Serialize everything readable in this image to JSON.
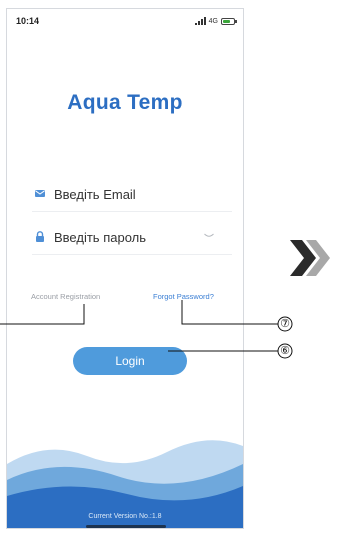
{
  "status_bar": {
    "time": "10:14",
    "network": "4G",
    "icons": [
      "signal-icon",
      "battery-icon"
    ]
  },
  "app": {
    "title": "Aqua Temp",
    "brand_color": "#2c6ec2"
  },
  "login_form": {
    "email_placeholder": "Введіть Email",
    "password_placeholder": "Введіть пароль",
    "email_icon": "mail-icon",
    "password_icon": "lock-icon",
    "password_toggle_icon": "eye-icon"
  },
  "links": {
    "register": "Account Registration",
    "forgot_password": "Forgot Password?"
  },
  "login_button": {
    "label": "Login",
    "color": "#4f9bdc"
  },
  "footer": {
    "version": "Current Version No.:1.8",
    "wave_colors": [
      "#bfd9f1",
      "#6fa8dc",
      "#2c6ec2"
    ]
  },
  "annotations": {
    "callouts": [
      "⑦",
      "⑥"
    ],
    "next_icon": "double-chevron-right-icon"
  }
}
